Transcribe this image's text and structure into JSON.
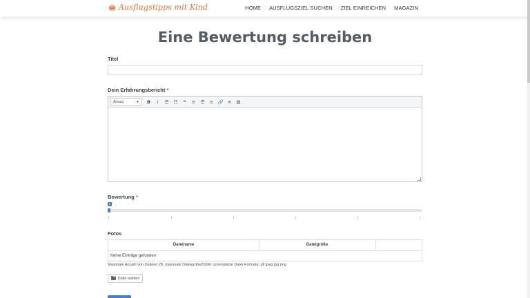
{
  "header": {
    "logo_text": "Ausflugstipps mit Kind",
    "nav": [
      "HOME",
      "AUSFLUGSZIEL SUCHEN",
      "ZIEL EINREICHEN",
      "MAGAZIN"
    ]
  },
  "page": {
    "title": "Eine Bewertung schreiben"
  },
  "form": {
    "title_label": "Titel",
    "title_value": "",
    "report_label": "Dein Erfahrungsbericht",
    "required_mark": "*",
    "editor": {
      "format_select": "Absatz"
    },
    "rating_label": "Bewertung",
    "rating_value": "0",
    "photos_label": "Fotos",
    "files_table": {
      "columns": [
        "Dateiname",
        "Dateigröße",
        ""
      ],
      "empty_text": "Keine Einträge gefunden"
    },
    "limits_text": "Maximale Anzahl von Dateien 20, maximale Dateigröße200M. Unterstützte Datei-Formate: gif jpeg jpg png",
    "file_button_label": "Datei wählen"
  },
  "colors": {
    "accent": "#e8743b",
    "primary": "#4d7fc9",
    "required": "#d9534f"
  }
}
